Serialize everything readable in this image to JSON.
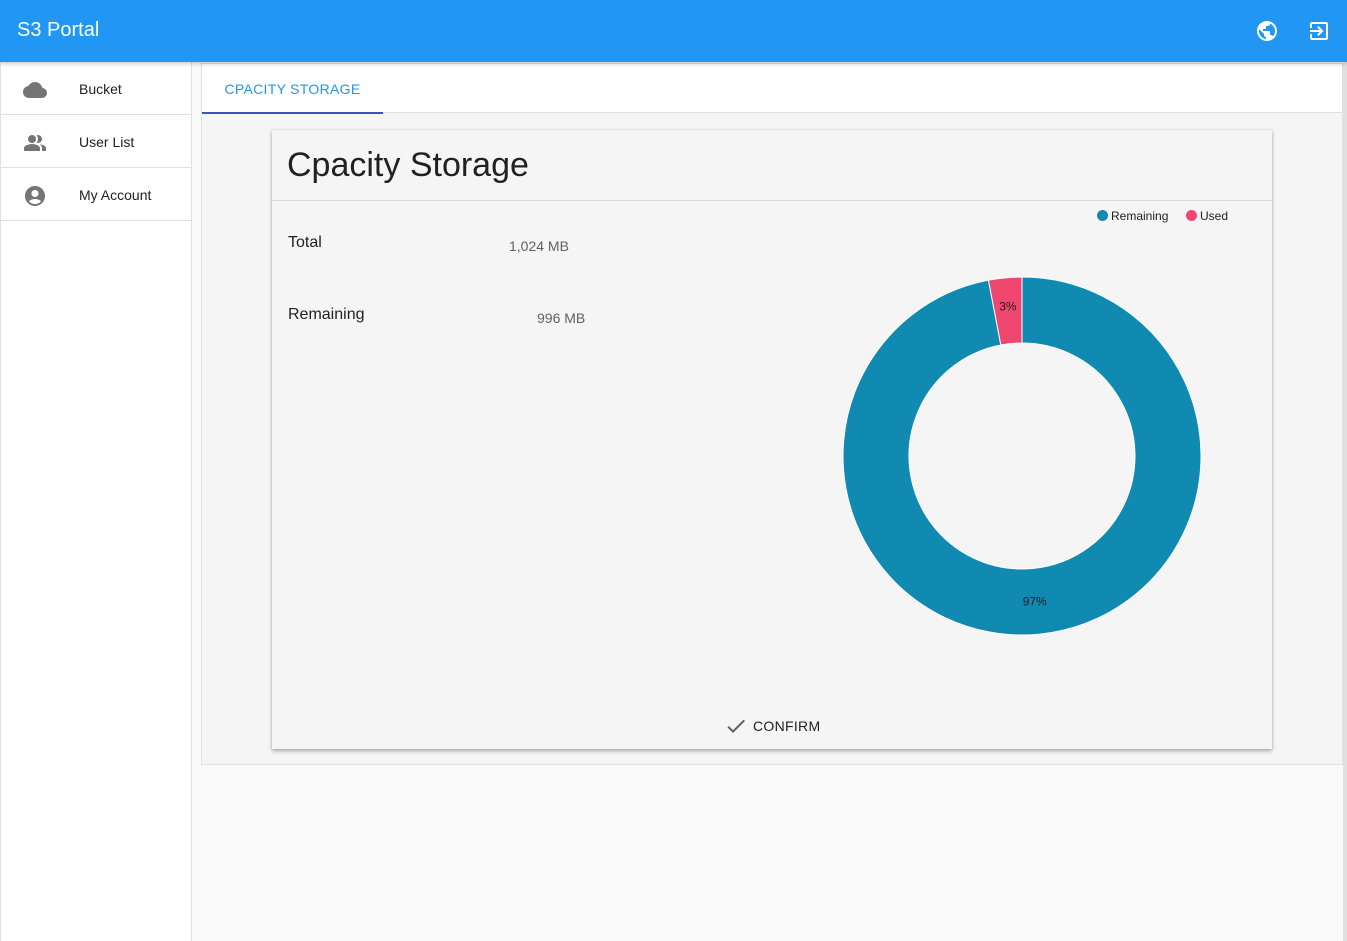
{
  "app": {
    "title": "S3 Portal"
  },
  "appbar": {
    "globe_icon": "globe-icon",
    "logout_icon": "exit-to-app-icon"
  },
  "sidebar": {
    "items": [
      {
        "label": "Bucket",
        "icon": "cloud-icon"
      },
      {
        "label": "User List",
        "icon": "people-icon"
      },
      {
        "label": "My Account",
        "icon": "account-circle-icon"
      }
    ]
  },
  "tabs": [
    {
      "label": "CPACITY STORAGE",
      "active": true
    }
  ],
  "card": {
    "title": "Cpacity Storage",
    "stats": [
      {
        "label": "Total",
        "value": "1,024 MB"
      },
      {
        "label": "Remaining",
        "value": "996 MB"
      }
    ],
    "confirm_label": "CONFIRM"
  },
  "colors": {
    "primary": "#2196f3",
    "remaining": "#118ab2",
    "used": "#ef476f"
  },
  "chart_data": {
    "type": "pie",
    "donut": true,
    "legend_position": "top-right",
    "labels": [
      "Remaining",
      "Used"
    ],
    "values": [
      97,
      3
    ],
    "data_labels": [
      "97%",
      "3%"
    ],
    "colors": [
      "#118ab2",
      "#ef476f"
    ]
  }
}
